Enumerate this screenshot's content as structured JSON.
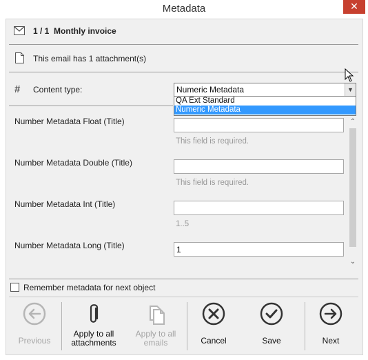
{
  "window": {
    "title": "Metadata",
    "close_glyph": "✕"
  },
  "header": {
    "counter": "1 / 1",
    "subject": "Monthly invoice",
    "icon": "envelope-icon"
  },
  "attachment_info": {
    "text": "This email has 1 attachment(s)",
    "icon": "document-icon"
  },
  "content_type": {
    "label": "Content type:",
    "icon": "hash-icon",
    "selected": "Numeric Metadata",
    "options": [
      "QA Ext Standard",
      "Numeric Metadata"
    ]
  },
  "fields": [
    {
      "label": "Number Metadata Float (Title)",
      "value": "",
      "hint": "This field is required."
    },
    {
      "label": "Number Metadata Double (Title)",
      "value": "",
      "hint": "This field is required."
    },
    {
      "label": "Number Metadata Int (Title)",
      "value": "",
      "hint": "1..5"
    },
    {
      "label": "Number Metadata Long (Title)",
      "value": "1",
      "hint": ""
    }
  ],
  "remember": {
    "label": "Remember metadata for next object",
    "checked": false
  },
  "buttons": [
    {
      "id": "previous",
      "label": "Previous",
      "enabled": false,
      "icon": "arrow-left-circle-icon"
    },
    {
      "id": "apply-attachments",
      "label": "Apply to all attachments",
      "line1": "Apply to all",
      "line2": "attachments",
      "enabled": true,
      "icon": "paperclip-icon"
    },
    {
      "id": "apply-emails",
      "label": "Apply to all emails",
      "line1": "Apply to all",
      "line2": "emails",
      "enabled": false,
      "icon": "copy-documents-icon"
    },
    {
      "id": "cancel",
      "label": "Cancel",
      "enabled": true,
      "icon": "x-circle-icon"
    },
    {
      "id": "save",
      "label": "Save",
      "enabled": true,
      "icon": "check-circle-icon"
    },
    {
      "id": "next",
      "label": "Next",
      "enabled": true,
      "icon": "arrow-right-circle-icon"
    }
  ],
  "colors": {
    "close_button": "#c7402f",
    "selection": "#3399ff",
    "panel_background": "#f0f0f0",
    "disabled_text": "#a5a5a5",
    "hint_text": "#999999"
  }
}
